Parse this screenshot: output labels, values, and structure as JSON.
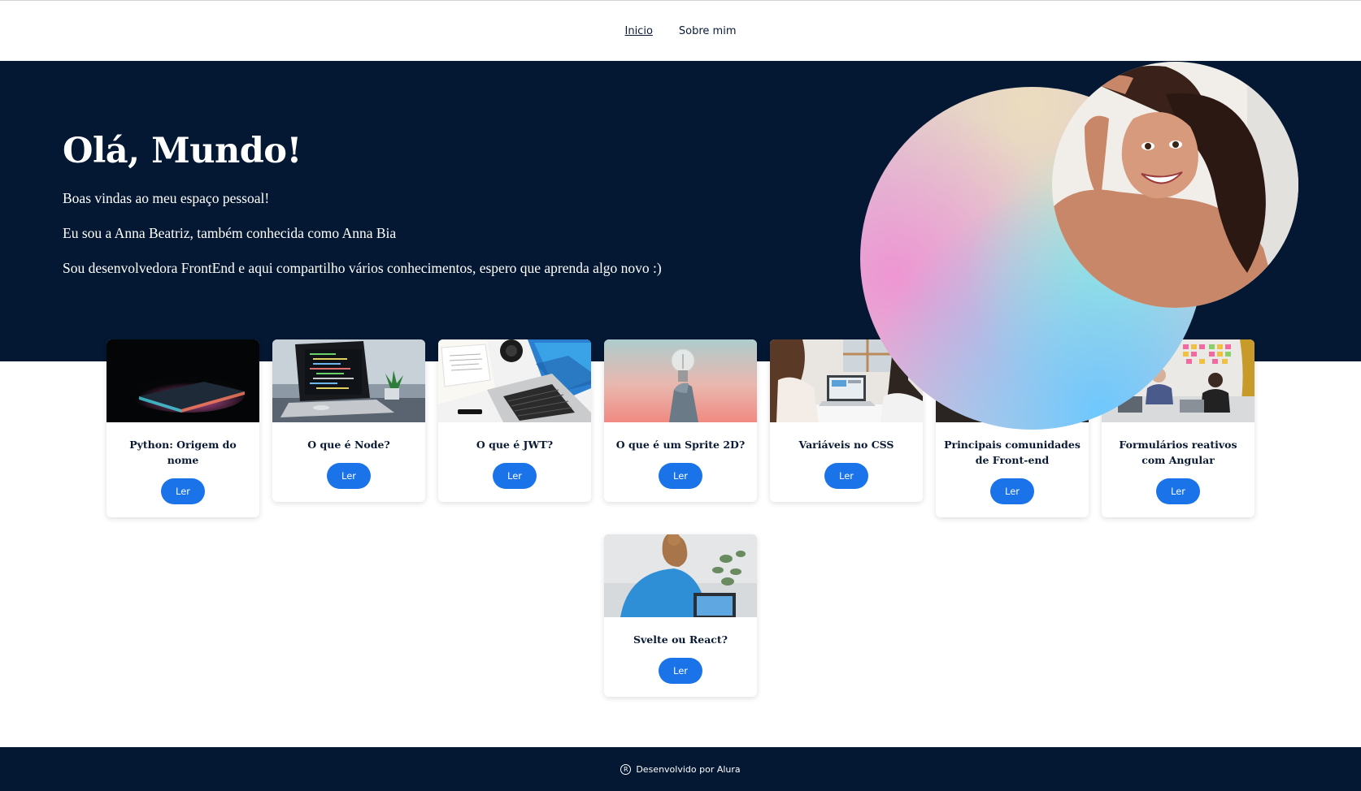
{
  "nav": {
    "items": [
      {
        "label": "Inicio",
        "active": true
      },
      {
        "label": "Sobre mim",
        "active": false
      }
    ]
  },
  "hero": {
    "title": "Olá, Mundo!",
    "line1": "Boas vindas ao meu espaço pessoal!",
    "line2": "Eu sou a Anna Beatriz, também conhecida como Anna Bia",
    "line3": "Sou desenvolvedora FrontEnd e aqui compartilho vários conhecimentos, espero que aprenda algo novo :)"
  },
  "cards": [
    {
      "title": "Python: Origem do nome",
      "button": "Ler",
      "image": "laptop-dark-icon"
    },
    {
      "title": "O que é Node?",
      "button": "Ler",
      "image": "code-laptop-icon"
    },
    {
      "title": "O que é JWT?",
      "button": "Ler",
      "image": "desk-laptop-icon"
    },
    {
      "title": "O que é um Sprite 2D?",
      "button": "Ler",
      "image": "lightbulb-icon"
    },
    {
      "title": "Variáveis no CSS",
      "button": "Ler",
      "image": "office-people-icon"
    },
    {
      "title": "Principais comunidades de Front-end",
      "button": "Ler",
      "image": "meeting-icon"
    },
    {
      "title": "Formulários reativos com Angular",
      "button": "Ler",
      "image": "team-sticky-notes-icon"
    },
    {
      "title": "Svelte ou React?",
      "button": "Ler",
      "image": "woman-laptop-icon"
    }
  ],
  "footer": {
    "symbol": "R",
    "text": "Desenvolvido por Alura"
  },
  "colors": {
    "navy": "#041833",
    "button": "#1a73e8",
    "text_dark": "#0a1a35"
  }
}
